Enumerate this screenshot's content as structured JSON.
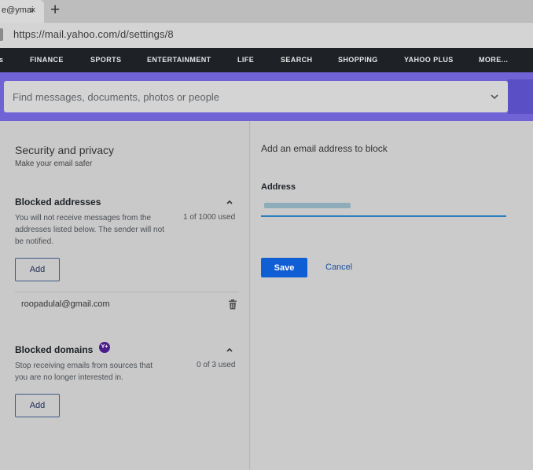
{
  "browser": {
    "tab_title": "e@ymai",
    "tab_close": "×",
    "new_tab": "+",
    "url": "https://mail.yahoo.com/d/settings/8"
  },
  "nav": {
    "items": [
      "s",
      "FINANCE",
      "SPORTS",
      "ENTERTAINMENT",
      "LIFE",
      "SEARCH",
      "SHOPPING",
      "YAHOO PLUS",
      "MORE..."
    ]
  },
  "search": {
    "placeholder": "Find messages, documents, photos or people"
  },
  "settings": {
    "title": "Security and privacy",
    "subtitle": "Make your email safer",
    "blocked_addresses": {
      "title": "Blocked addresses",
      "description": "You will not receive messages from the addresses listed below. The sender will not be notified.",
      "used": "1 of 1000 used",
      "add_label": "Add",
      "items": [
        "roopadulal@gmail.com"
      ]
    },
    "blocked_domains": {
      "title": "Blocked domains",
      "badge": "Y+",
      "description": "Stop receiving emails from sources that you are no longer interested in.",
      "used": "0 of 3 used",
      "add_label": "Add"
    }
  },
  "form": {
    "title": "Add an email address to block",
    "address_label": "Address",
    "save_label": "Save",
    "cancel_label": "Cancel"
  },
  "colors": {
    "nav_bg": "#1e2227",
    "search_band": "#6f63d6",
    "primary_button": "#0f5ed4",
    "input_underline": "#2f7fc0",
    "plus_badge": "#4b1c8c"
  }
}
